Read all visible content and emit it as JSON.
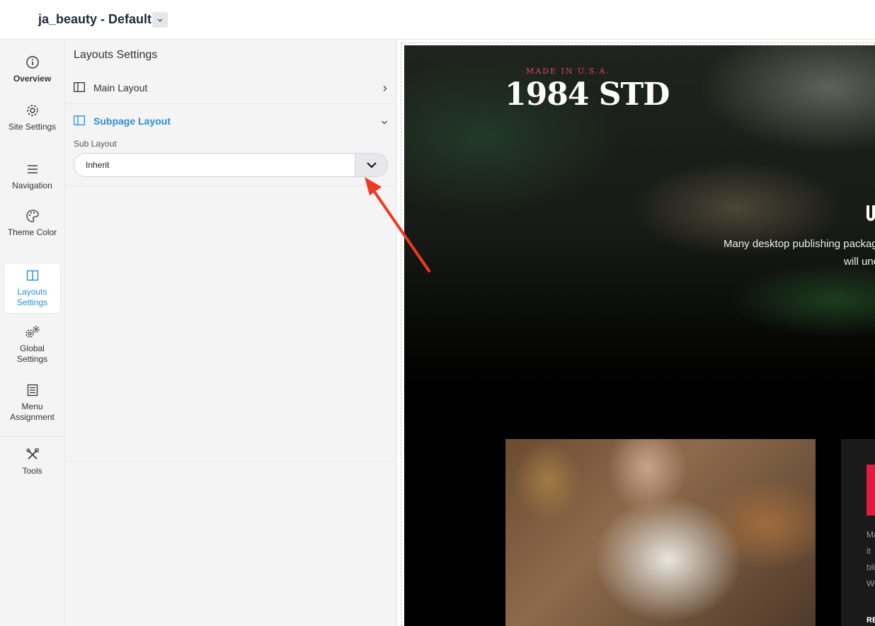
{
  "header": {
    "title": "ja_beauty - Default"
  },
  "sidebar": {
    "items": [
      {
        "label": "Overview",
        "icon": "info-icon"
      },
      {
        "label": "Site Settings",
        "icon": "gear-icon"
      },
      {
        "label": "Navigation",
        "icon": "menu-icon"
      },
      {
        "label": "Theme Color",
        "icon": "palette-icon"
      },
      {
        "label": "Layouts Settings",
        "icon": "layout-icon",
        "active": true
      },
      {
        "label": "Global Settings",
        "icon": "gears-icon"
      },
      {
        "label": "Menu Assignment",
        "icon": "list-icon"
      },
      {
        "label": "Tools",
        "icon": "tools-icon"
      }
    ]
  },
  "panel": {
    "title": "Layouts Settings",
    "main_layout": {
      "label": "Main Layout"
    },
    "subpage_layout": {
      "label": "Subpage Layout",
      "field_label": "Sub Layout",
      "value": "Inherit"
    }
  },
  "preview": {
    "made_in": "MADE IN U.S.A.",
    "brand": "1984 STD",
    "hero_line1": "Many desktop publishing packages",
    "hero_line2": "will unc",
    "card_lines": [
      "Ma",
      "it",
      "bli",
      "We"
    ],
    "card_link": "RE"
  },
  "colors": {
    "accent": "#2b8fd0",
    "annotation_arrow": "#ee3a24",
    "brand_red": "#e21b3c"
  }
}
